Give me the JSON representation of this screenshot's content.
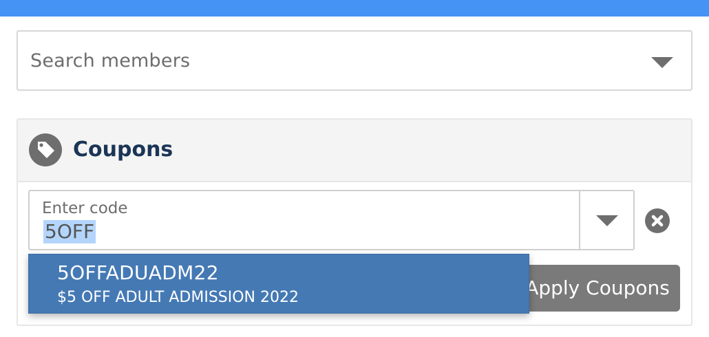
{
  "colors": {
    "accent_bar": "#4593f5",
    "panel_title": "#1b3557",
    "highlight": "#4479b4",
    "button": "#7a7a7a"
  },
  "search": {
    "placeholder": "Search members",
    "icon": "chevron-down-icon"
  },
  "coupons": {
    "title": "Coupons",
    "icon": "tag-icon",
    "code_field": {
      "label": "Enter code",
      "value": "5OFF"
    },
    "dropdown_icon": "chevron-down-icon",
    "clear_icon": "close-circle-icon",
    "apply_label": "Apply Coupons",
    "suggestions": [
      {
        "code": "5OFFADUADM22",
        "description": "$5 OFF ADULT ADMISSION 2022"
      }
    ]
  }
}
